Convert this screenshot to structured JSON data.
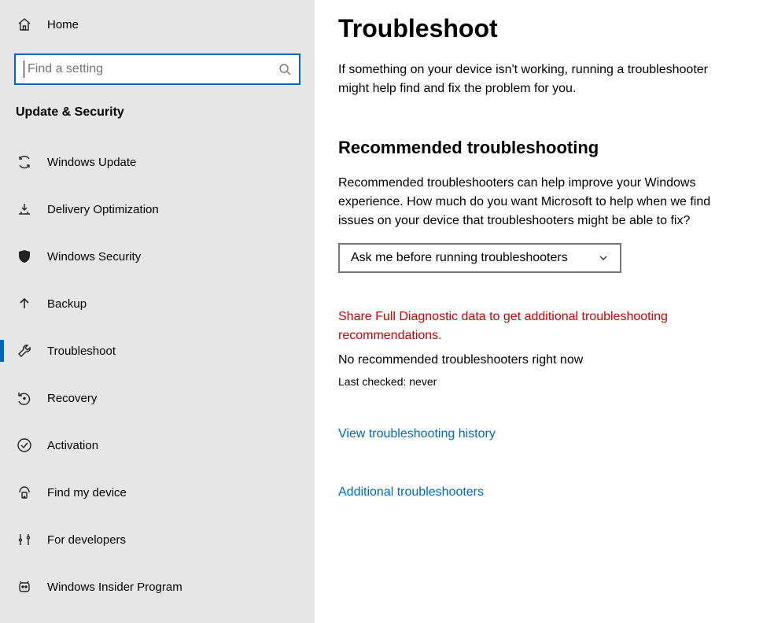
{
  "sidebar": {
    "home": "Home",
    "search_placeholder": "Find a setting",
    "section_header": "Update & Security",
    "items": [
      {
        "label": "Windows Update",
        "icon": "sync-icon"
      },
      {
        "label": "Delivery Optimization",
        "icon": "download-opt-icon"
      },
      {
        "label": "Windows Security",
        "icon": "shield-icon"
      },
      {
        "label": "Backup",
        "icon": "backup-arrow-icon"
      },
      {
        "label": "Troubleshoot",
        "icon": "wrench-icon"
      },
      {
        "label": "Recovery",
        "icon": "recovery-icon"
      },
      {
        "label": "Activation",
        "icon": "activation-check-icon"
      },
      {
        "label": "Find my device",
        "icon": "find-device-icon"
      },
      {
        "label": "For developers",
        "icon": "tools-icon"
      },
      {
        "label": "Windows Insider Program",
        "icon": "insider-icon"
      }
    ]
  },
  "main": {
    "title": "Troubleshoot",
    "intro": "If something on your device isn't working, running a troubleshooter might help find and fix the problem for you.",
    "recommended": {
      "title": "Recommended troubleshooting",
      "desc": "Recommended troubleshooters can help improve your Windows experience. How much do you want Microsoft to help when we find issues on your device that troubleshooters might be able to fix?",
      "dropdown_value": "Ask me before running troubleshooters",
      "warning": "Share Full Diagnostic data to get additional troubleshooting recommendations.",
      "no_rec": "No recommended troubleshooters right now",
      "last_checked": "Last checked: never"
    },
    "links": {
      "history": "View troubleshooting history",
      "additional": "Additional troubleshooters"
    }
  },
  "colors": {
    "accent": "#0067c0",
    "warning": "#d10000"
  }
}
